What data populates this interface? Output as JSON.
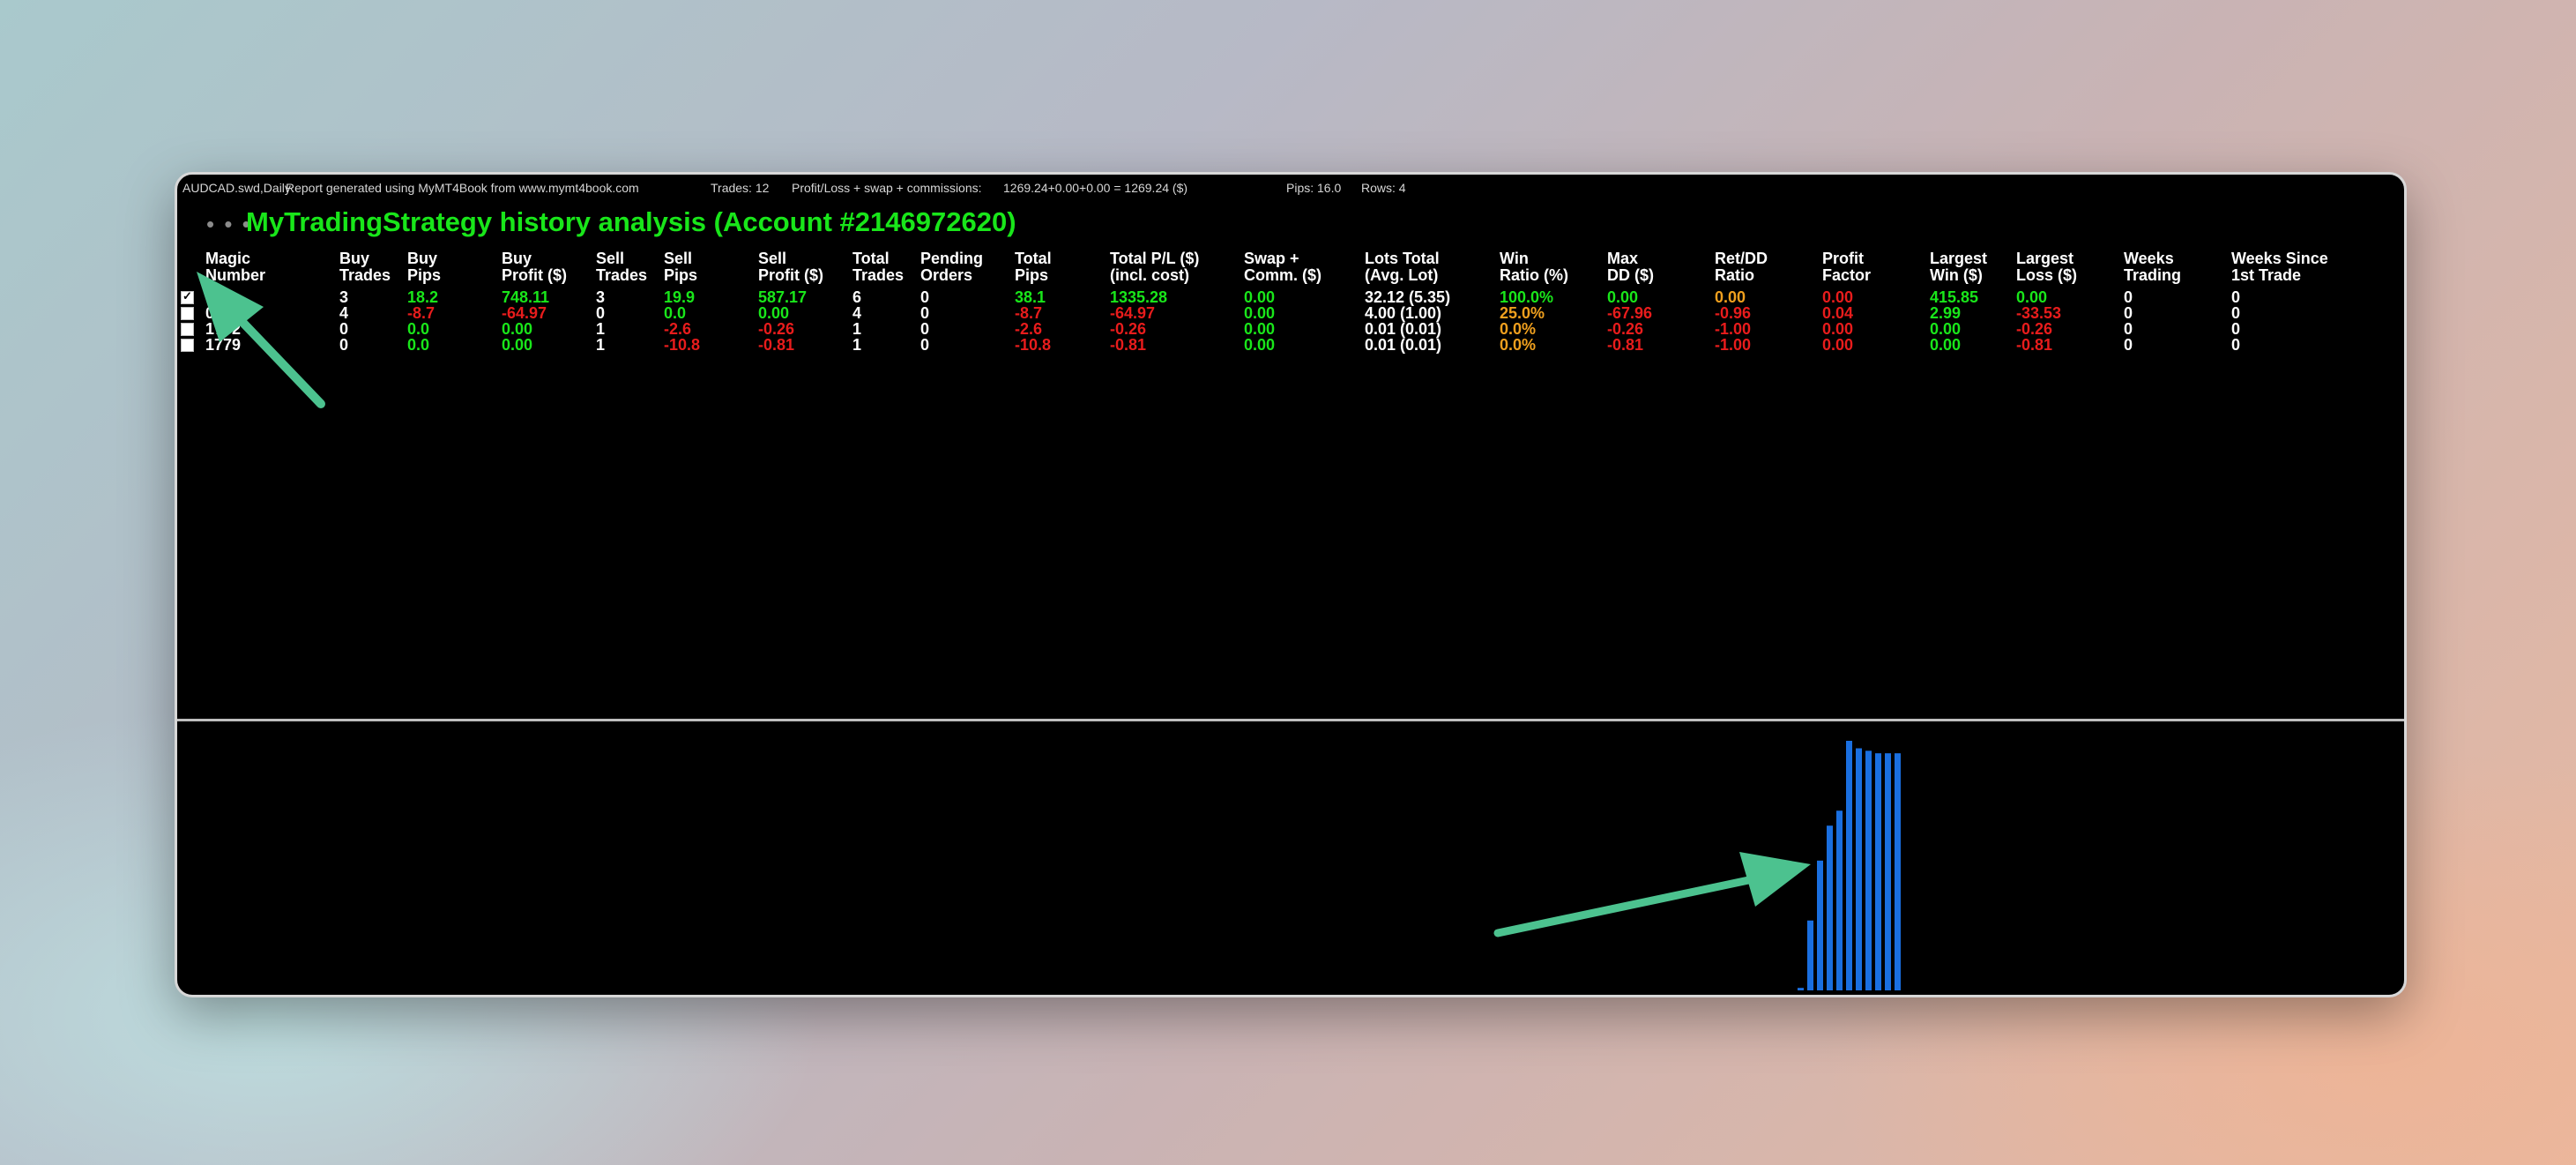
{
  "status_bar": {
    "symbol": "AUDCAD.swd,Daily",
    "report_note": "Report generated using MyMT4Book from www.mymt4book.com",
    "trades": "Trades: 12",
    "pl_label": "Profit/Loss + swap + commissions:",
    "pl_value": "1269.24+0.00+0.00 = 1269.24 ($)",
    "pips": "Pips: 16.0",
    "rows": "Rows: 4"
  },
  "title": "MyTradingStrategy history analysis (Account #2146972620)",
  "title_dots": "• • •",
  "columns": [
    [
      "Magic",
      "Number"
    ],
    [
      "Buy",
      "Trades"
    ],
    [
      "Buy",
      "Pips"
    ],
    [
      "Buy",
      "Profit ($)"
    ],
    [
      "Sell",
      "Trades"
    ],
    [
      "Sell",
      "Pips"
    ],
    [
      "Sell",
      "Profit ($)"
    ],
    [
      "Total",
      "Trades"
    ],
    [
      "Pending",
      "Orders"
    ],
    [
      "Total",
      "Pips"
    ],
    [
      "Total P/L ($)",
      "(incl. cost)"
    ],
    [
      "Swap +",
      "Comm. ($)"
    ],
    [
      "Lots Total",
      "(Avg. Lot)"
    ],
    [
      "Win",
      "Ratio (%)"
    ],
    [
      "Max",
      "DD ($)"
    ],
    [
      "Ret/DD",
      "Ratio"
    ],
    [
      "Profit",
      "Factor"
    ],
    [
      "Largest",
      "Win ($)"
    ],
    [
      "Largest",
      "Loss ($)"
    ],
    [
      "Weeks",
      "Trading"
    ],
    [
      "Weeks Since",
      "1st Trade"
    ]
  ],
  "rows": [
    {
      "checked": true,
      "cells": [
        {
          "v": "",
          "c": "white"
        },
        {
          "v": "3",
          "c": "white"
        },
        {
          "v": "18.2",
          "c": "green"
        },
        {
          "v": "748.11",
          "c": "green"
        },
        {
          "v": "3",
          "c": "white"
        },
        {
          "v": "19.9",
          "c": "green"
        },
        {
          "v": "587.17",
          "c": "green"
        },
        {
          "v": "6",
          "c": "white"
        },
        {
          "v": "0",
          "c": "white"
        },
        {
          "v": "38.1",
          "c": "green"
        },
        {
          "v": "1335.28",
          "c": "green"
        },
        {
          "v": "0.00",
          "c": "green"
        },
        {
          "v": "32.12 (5.35)",
          "c": "white"
        },
        {
          "v": "100.0%",
          "c": "green"
        },
        {
          "v": "0.00",
          "c": "green"
        },
        {
          "v": "0.00",
          "c": "orange"
        },
        {
          "v": "0.00",
          "c": "red"
        },
        {
          "v": "415.85",
          "c": "green"
        },
        {
          "v": "0.00",
          "c": "green"
        },
        {
          "v": "0",
          "c": "white"
        },
        {
          "v": "0",
          "c": "white"
        }
      ]
    },
    {
      "checked": false,
      "cells": [
        {
          "v": "0",
          "c": "white"
        },
        {
          "v": "4",
          "c": "white"
        },
        {
          "v": "-8.7",
          "c": "red"
        },
        {
          "v": "-64.97",
          "c": "red"
        },
        {
          "v": "0",
          "c": "white"
        },
        {
          "v": "0.0",
          "c": "green"
        },
        {
          "v": "0.00",
          "c": "green"
        },
        {
          "v": "4",
          "c": "white"
        },
        {
          "v": "0",
          "c": "white"
        },
        {
          "v": "-8.7",
          "c": "red"
        },
        {
          "v": "-64.97",
          "c": "red"
        },
        {
          "v": "0.00",
          "c": "green"
        },
        {
          "v": "4.00 (1.00)",
          "c": "white"
        },
        {
          "v": "25.0%",
          "c": "orange"
        },
        {
          "v": "-67.96",
          "c": "red"
        },
        {
          "v": "-0.96",
          "c": "red"
        },
        {
          "v": "0.04",
          "c": "red"
        },
        {
          "v": "2.99",
          "c": "green"
        },
        {
          "v": "-33.53",
          "c": "red"
        },
        {
          "v": "0",
          "c": "white"
        },
        {
          "v": "0",
          "c": "white"
        }
      ]
    },
    {
      "checked": false,
      "cells": [
        {
          "v": "1782",
          "c": "white"
        },
        {
          "v": "0",
          "c": "white"
        },
        {
          "v": "0.0",
          "c": "green"
        },
        {
          "v": "0.00",
          "c": "green"
        },
        {
          "v": "1",
          "c": "white"
        },
        {
          "v": "-2.6",
          "c": "red"
        },
        {
          "v": "-0.26",
          "c": "red"
        },
        {
          "v": "1",
          "c": "white"
        },
        {
          "v": "0",
          "c": "white"
        },
        {
          "v": "-2.6",
          "c": "red"
        },
        {
          "v": "-0.26",
          "c": "red"
        },
        {
          "v": "0.00",
          "c": "green"
        },
        {
          "v": "0.01 (0.01)",
          "c": "white"
        },
        {
          "v": "0.0%",
          "c": "orange"
        },
        {
          "v": "-0.26",
          "c": "red"
        },
        {
          "v": "-1.00",
          "c": "red"
        },
        {
          "v": "0.00",
          "c": "red"
        },
        {
          "v": "0.00",
          "c": "green"
        },
        {
          "v": "-0.26",
          "c": "red"
        },
        {
          "v": "0",
          "c": "white"
        },
        {
          "v": "0",
          "c": "white"
        }
      ]
    },
    {
      "checked": false,
      "cells": [
        {
          "v": "1779",
          "c": "white"
        },
        {
          "v": "0",
          "c": "white"
        },
        {
          "v": "0.0",
          "c": "green"
        },
        {
          "v": "0.00",
          "c": "green"
        },
        {
          "v": "1",
          "c": "white"
        },
        {
          "v": "-10.8",
          "c": "red"
        },
        {
          "v": "-0.81",
          "c": "red"
        },
        {
          "v": "1",
          "c": "white"
        },
        {
          "v": "0",
          "c": "white"
        },
        {
          "v": "-10.8",
          "c": "red"
        },
        {
          "v": "-0.81",
          "c": "red"
        },
        {
          "v": "0.00",
          "c": "green"
        },
        {
          "v": "0.01 (0.01)",
          "c": "white"
        },
        {
          "v": "0.0%",
          "c": "orange"
        },
        {
          "v": "-0.81",
          "c": "red"
        },
        {
          "v": "-1.00",
          "c": "red"
        },
        {
          "v": "0.00",
          "c": "red"
        },
        {
          "v": "0.00",
          "c": "green"
        },
        {
          "v": "-0.81",
          "c": "red"
        },
        {
          "v": "0",
          "c": "white"
        },
        {
          "v": "0",
          "c": "white"
        }
      ]
    }
  ],
  "colors": {
    "green": "#19e61a",
    "red": "#e81c1c",
    "orange": "#f0a01e",
    "white": "#ffffff",
    "bar": "#1a6fe0",
    "arrow": "#4cc28f"
  },
  "equity_bars": [
    1,
    28,
    52,
    66,
    72,
    100,
    97,
    96,
    95,
    95,
    95
  ]
}
